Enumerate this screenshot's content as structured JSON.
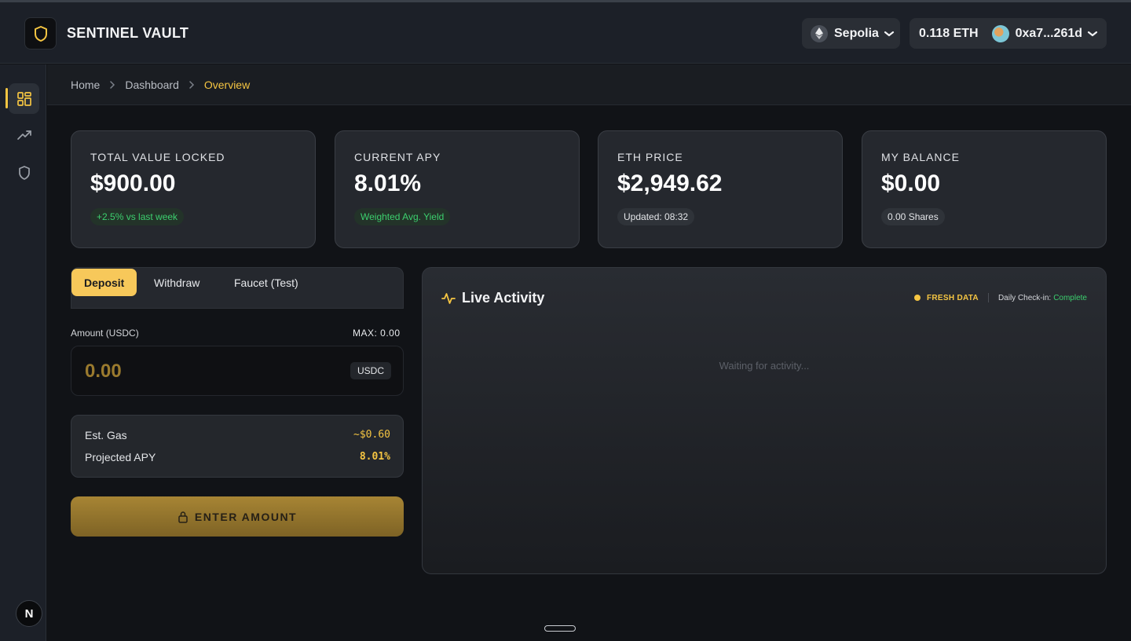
{
  "header": {
    "brand": "SENTINEL VAULT",
    "network": "Sepolia",
    "eth_balance": "0.118 ETH",
    "address": "0xa7...261d"
  },
  "sidebar": {
    "items": [
      {
        "icon": "dashboard-grid-icon",
        "active": true
      },
      {
        "icon": "trending-up-icon",
        "active": false
      },
      {
        "icon": "shield-icon",
        "active": false
      }
    ],
    "badge": "N"
  },
  "breadcrumb": [
    "Home",
    "Dashboard",
    "Overview"
  ],
  "stats": [
    {
      "label": "TOTAL VALUE LOCKED",
      "value": "$900.00",
      "pill": "+2.5% vs last week"
    },
    {
      "label": "CURRENT APY",
      "value": "8.01%",
      "pill": "Weighted Avg. Yield"
    },
    {
      "label": "ETH PRICE",
      "value": "$2,949.62",
      "pill": "Updated: 08:32"
    },
    {
      "label": "MY BALANCE",
      "value": "$0.00",
      "pill": "0.00 Shares"
    }
  ],
  "deposit": {
    "tabs": [
      "Deposit",
      "Withdraw",
      "Faucet (Test)"
    ],
    "amount_label": "Amount (USDC)",
    "max_label": "MAX: 0.00",
    "amount_value": "0.00",
    "currency": "USDC",
    "est_gas_label": "Est. Gas",
    "est_gas_value": "~$0.60",
    "projected_apy_label": "Projected APY",
    "projected_apy_value": "8.01%",
    "submit_label": "ENTER AMOUNT"
  },
  "activity": {
    "title": "Live Activity",
    "fresh_label": "FRESH DATA",
    "checkin_label": "Daily Check-in:",
    "checkin_status": "Complete",
    "empty_text": "Waiting for activity..."
  },
  "colors": {
    "accent": "#f5c542",
    "positive": "#3ccf6e",
    "background": "#111317"
  }
}
